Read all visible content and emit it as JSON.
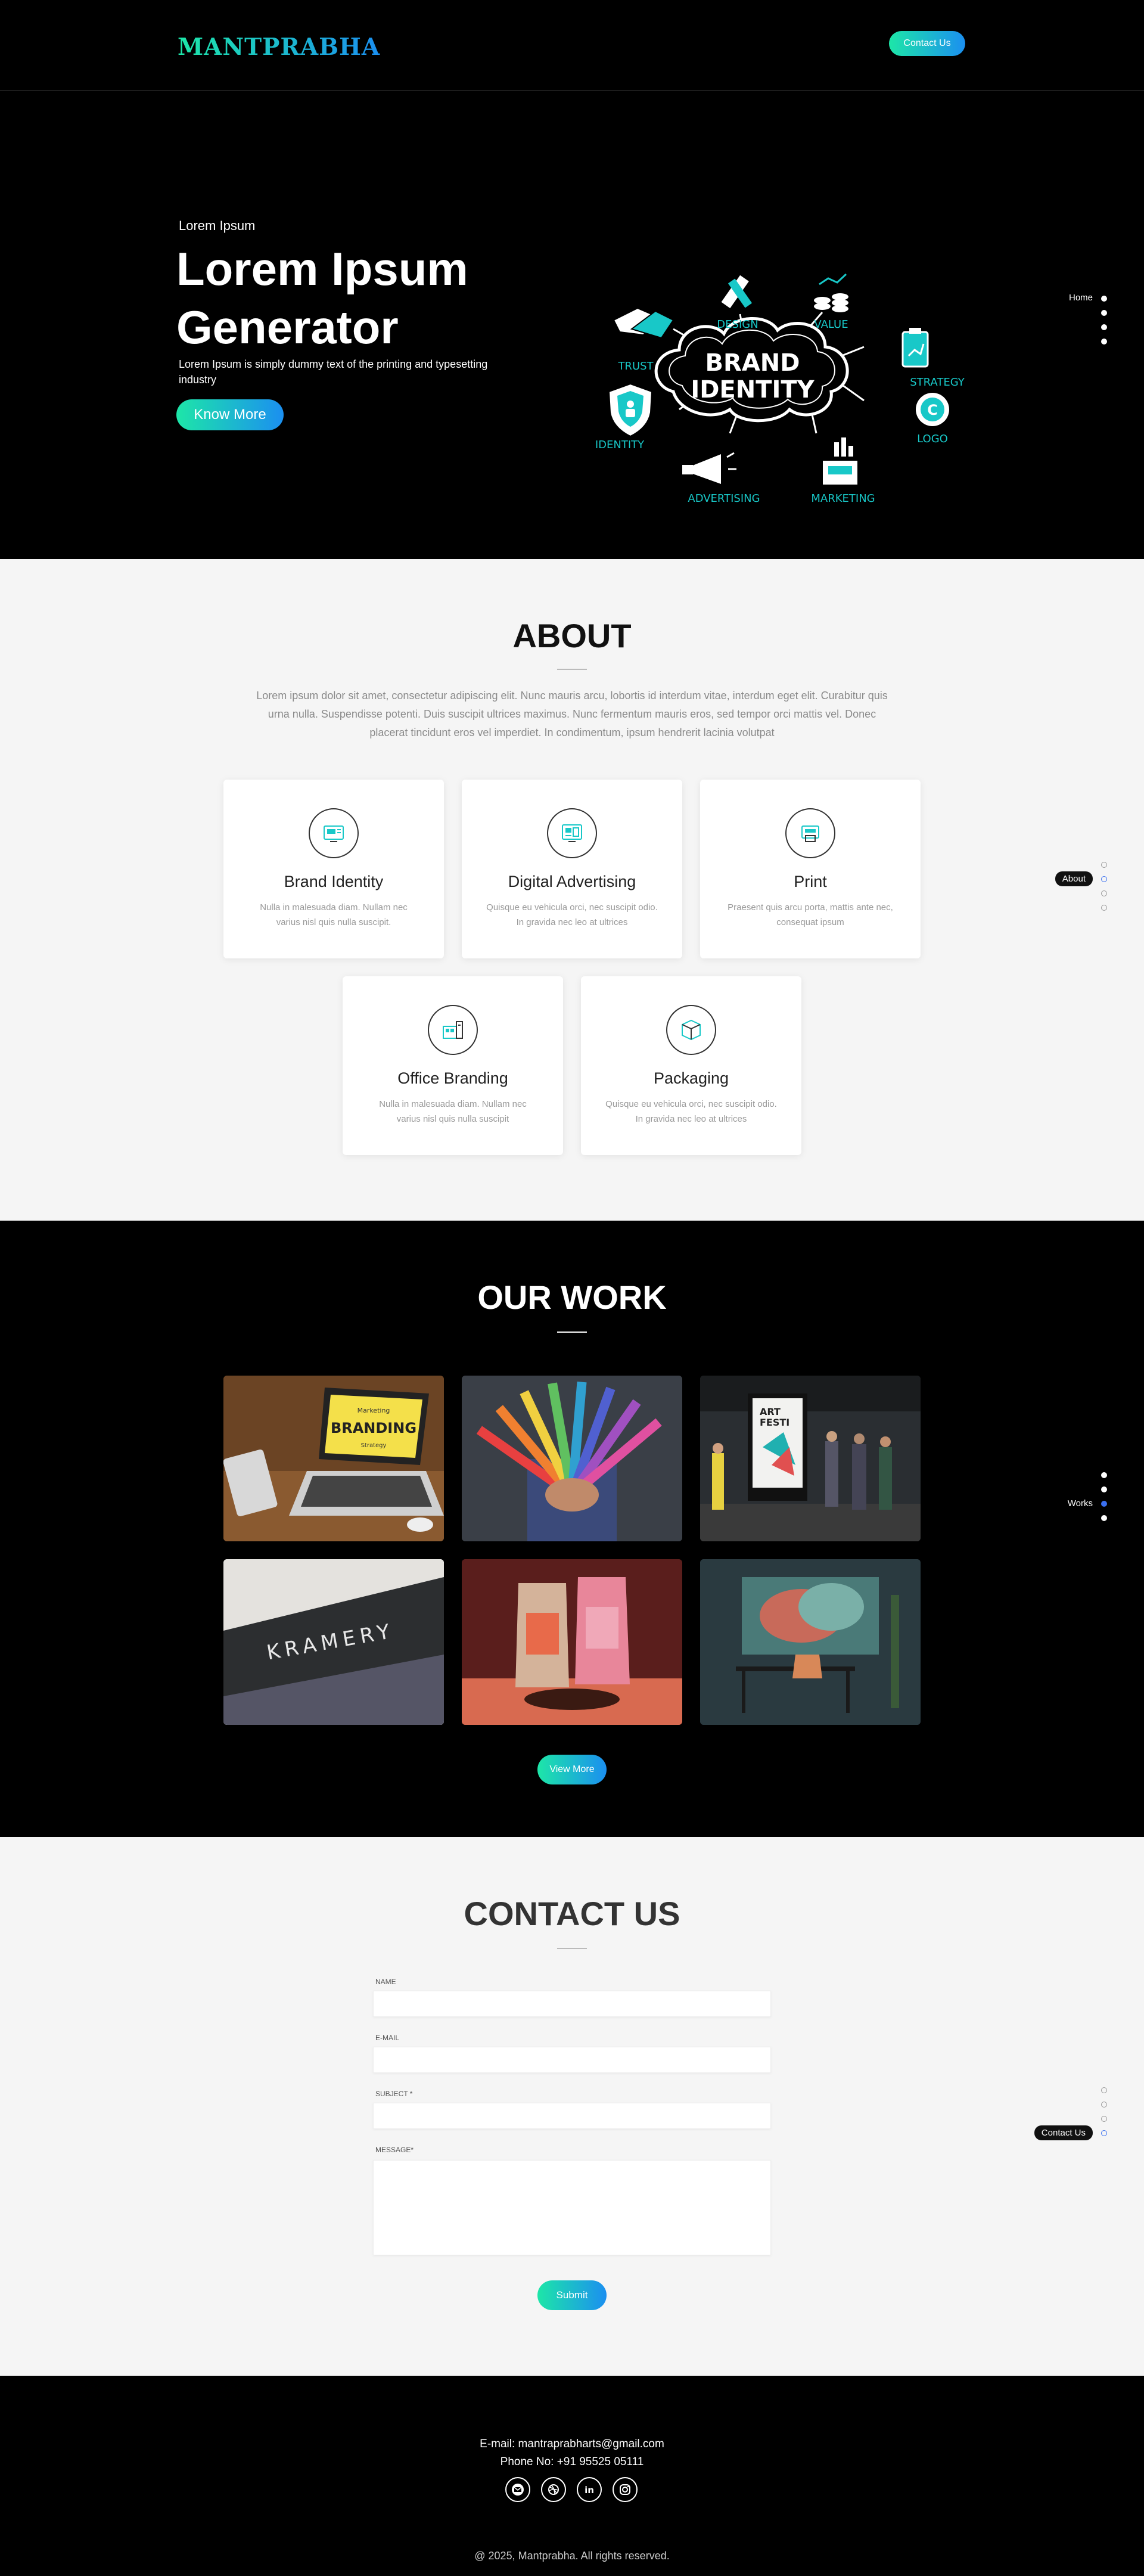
{
  "header": {
    "logo": "MANTPRABHA",
    "contact_button": "Contact Us"
  },
  "hero": {
    "kicker": "Lorem Ipsum",
    "title": "Lorem Ipsum Generator",
    "description": "Lorem Ipsum is simply dummy text of the printing and typesetting industry",
    "cta": "Know More",
    "art": {
      "center": [
        "BRAND",
        "IDENTITY"
      ],
      "labels": [
        "TRUST",
        "DESIGN",
        "VALUE",
        "STRATEGY",
        "LOGO",
        "MARKETING",
        "ADVERTISING",
        "IDENTITY"
      ]
    }
  },
  "sidenav": {
    "home": "Home",
    "about": "About",
    "works": "Works",
    "contact": "Contact Us"
  },
  "about": {
    "title": "ABOUT",
    "text": "Lorem ipsum dolor sit amet, consectetur adipiscing elit. Nunc mauris arcu, lobortis id interdum vitae, interdum eget elit. Curabitur quis urna nulla. Suspendisse potenti. Duis suscipit ultrices maximus. Nunc fermentum mauris eros, sed tempor orci mattis vel. Donec placerat tincidunt eros vel imperdiet. In condimentum, ipsum hendrerit lacinia volutpat",
    "cards": [
      {
        "title": "Brand Identity",
        "text": "Nulla in malesuada diam. Nullam nec varius nisl quis nulla suscipit."
      },
      {
        "title": "Digital Advertising",
        "text": "Quisque eu vehicula orci, nec suscipit odio. In gravida nec leo at ultrices"
      },
      {
        "title": "Print",
        "text": "Praesent quis arcu porta, mattis ante nec, consequat ipsum"
      },
      {
        "title": "Office Branding",
        "text": "Nulla in malesuada diam. Nullam nec varius nisl quis nulla suscipit"
      },
      {
        "title": "Packaging",
        "text": "Quisque eu vehicula orci, nec suscipit odio. In gravida nec leo at ultrices"
      }
    ]
  },
  "works": {
    "title": "OUR WORK",
    "laptop_screen": {
      "small": "Marketing",
      "big": "BRANDING",
      "sub": "Strategy"
    },
    "poster": {
      "line1": "ART",
      "line2": "FESTI"
    },
    "sign": "KRAMERY",
    "button": "View More"
  },
  "contact": {
    "title": "CONTACT US",
    "fields": {
      "name": "NAME",
      "email": "E-MAIL",
      "subject": "SUBJECT *",
      "message": "MESSAGE*"
    },
    "submit": "Submit"
  },
  "footer": {
    "email": "E-mail: mantraprabharts@gmail.com",
    "phone": "Phone No: +91 95525 05111",
    "copyright": "@ 2025, Mantprabha. All rights reserved."
  },
  "colors": {
    "accent_start": "#1de6a8",
    "accent_end": "#1b8ff0",
    "teal": "#18c8c8"
  }
}
